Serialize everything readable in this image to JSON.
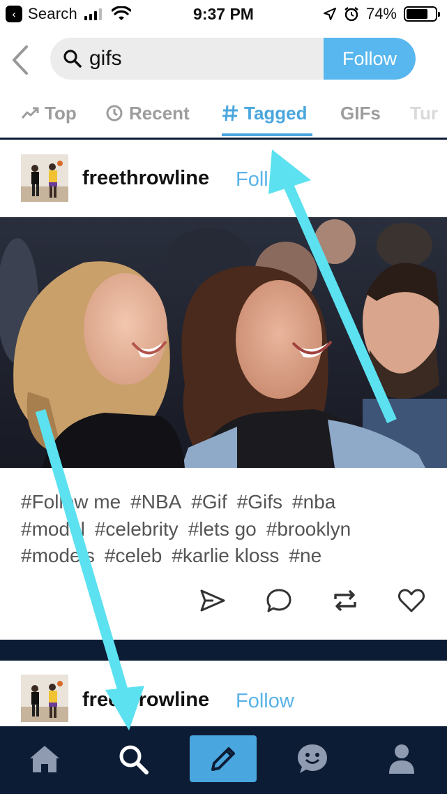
{
  "status_bar": {
    "back_app_label": "Search",
    "time": "9:37 PM",
    "battery_percent": "74%",
    "battery_level": 0.74
  },
  "search": {
    "query": "gifs",
    "follow_label": "Follow"
  },
  "tabs": [
    {
      "label": "Top",
      "icon": "trending-icon",
      "active": false
    },
    {
      "label": "Recent",
      "icon": "clock-icon",
      "active": false
    },
    {
      "label": "Tagged",
      "icon": "hash-icon",
      "active": true
    },
    {
      "label": "GIFs",
      "icon": "",
      "active": false
    },
    {
      "label": "Tur",
      "icon": "",
      "active": false
    }
  ],
  "posts": [
    {
      "username": "freethrowline",
      "follow_label": "Follow",
      "follow_label_visible": "Foll",
      "tags": [
        "#Follow me",
        "#NBA",
        "#Gif",
        "#Gifs",
        "#nba",
        "#model",
        "#celebrity",
        "#lets go",
        "#brooklyn",
        "#models",
        "#celeb",
        "#karlie kloss",
        "#ne"
      ]
    },
    {
      "username": "freethrowline",
      "follow_label": "Follow"
    }
  ],
  "actions": [
    "share-icon",
    "comment-icon",
    "reblog-icon",
    "like-icon"
  ],
  "bottom_nav": [
    "home-icon",
    "search-icon",
    "compose-icon",
    "activity-icon",
    "account-icon"
  ],
  "colors": {
    "accent": "#4aa6de",
    "follow_button": "#58b7ee",
    "nav_background": "#0d1c35",
    "annotation_arrow": "#5ce1f0"
  }
}
